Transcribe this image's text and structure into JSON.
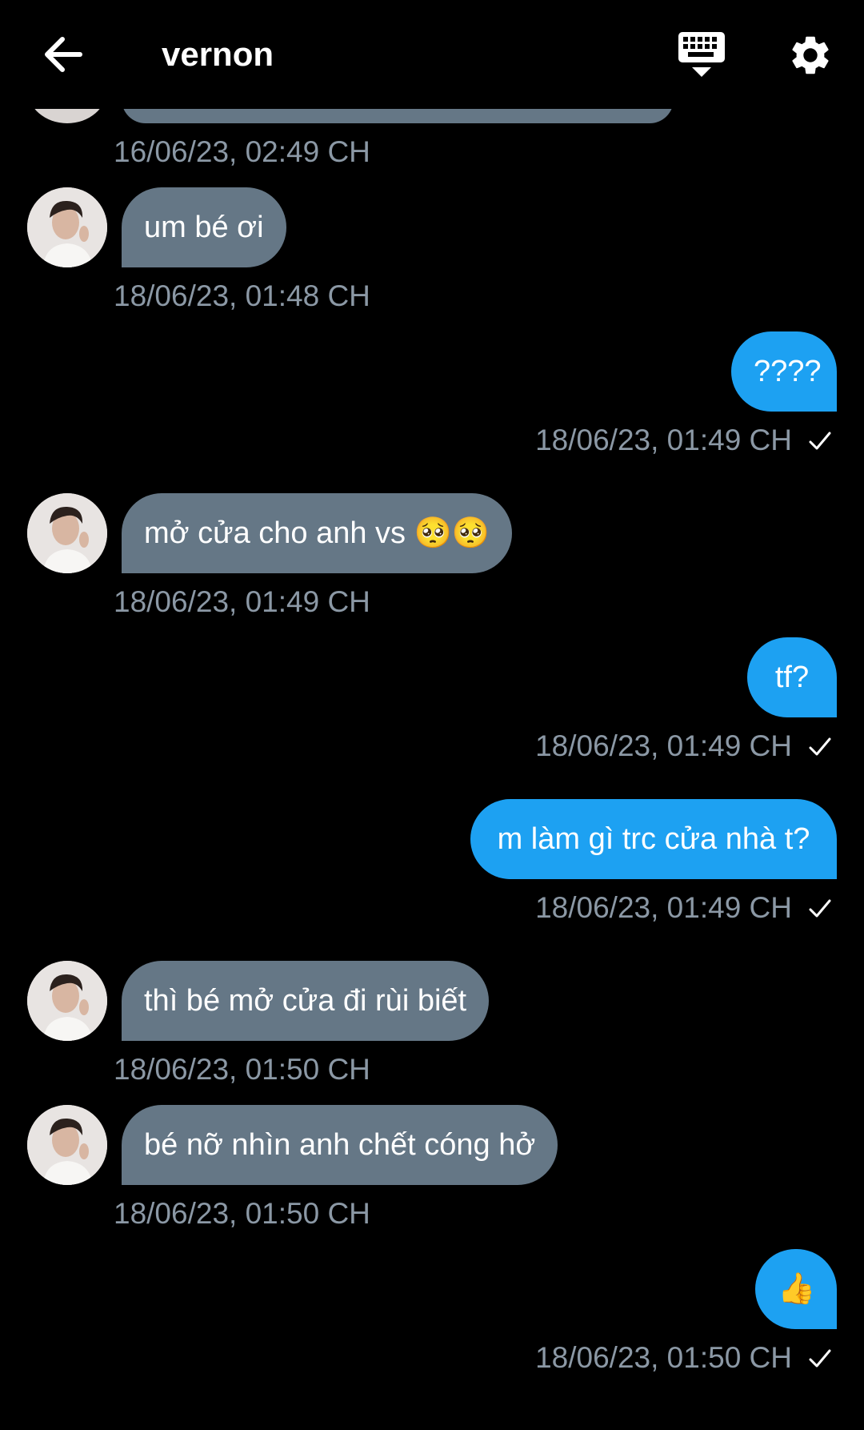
{
  "header": {
    "title": "vernon"
  },
  "colors": {
    "incoming_bubble": "#657786",
    "outgoing_bubble": "#1da1f2",
    "timestamp": "#8b98a5",
    "background": "#000000"
  },
  "icons": {
    "back": "arrow-left-icon",
    "keyboard": "keyboard-icon",
    "settings": "gear-icon",
    "read": "checkmark-icon"
  },
  "messages": [
    {
      "direction": "in",
      "text": "",
      "time": "16/06/23, 02:49 CH"
    },
    {
      "direction": "in",
      "text": "um bé ơi",
      "time": "18/06/23, 01:48 CH"
    },
    {
      "direction": "out",
      "text": "????",
      "time": "18/06/23, 01:49 CH"
    },
    {
      "direction": "in",
      "text": "mở cửa cho anh vs 🥺🥺",
      "time": "18/06/23, 01:49 CH"
    },
    {
      "direction": "out",
      "text": "tf?",
      "time": "18/06/23, 01:49 CH"
    },
    {
      "direction": "out",
      "text": "m làm gì trc cửa nhà t?",
      "time": "18/06/23, 01:49 CH"
    },
    {
      "direction": "in",
      "text": "thì bé mở cửa đi rùi biết",
      "time": "18/06/23, 01:50 CH"
    },
    {
      "direction": "in",
      "text": "bé nỡ nhìn anh chết cóng hở",
      "time": "18/06/23, 01:50 CH"
    },
    {
      "direction": "out",
      "text": "👍",
      "time": "18/06/23, 01:50 CH"
    }
  ]
}
